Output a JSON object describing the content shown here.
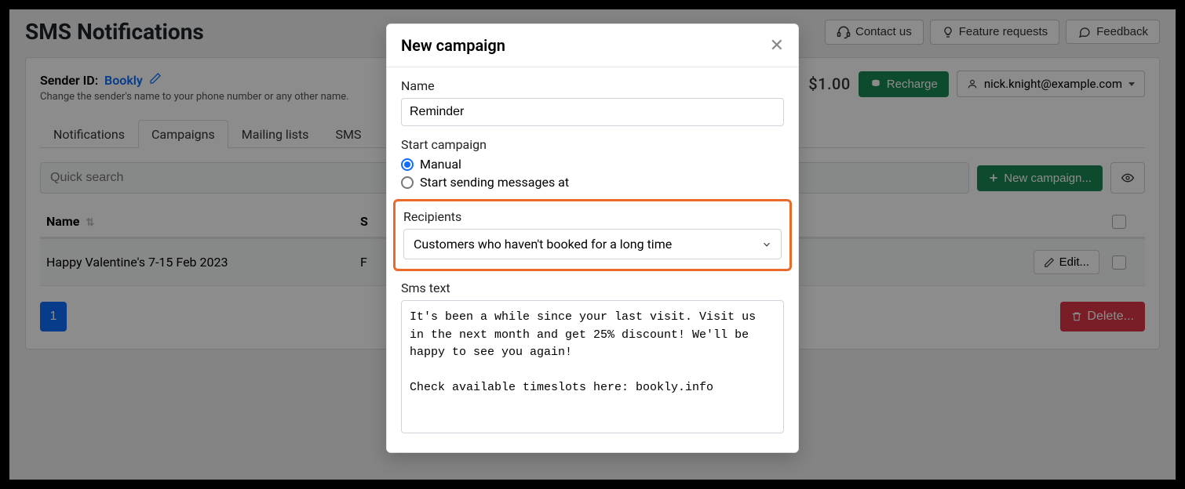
{
  "page": {
    "title": "SMS Notifications"
  },
  "header_buttons": {
    "contact": "Contact us",
    "feature": "Feature requests",
    "feedback": "Feedback"
  },
  "sender": {
    "label": "Sender ID:",
    "value": "Bookly",
    "sub": "Change the sender's name to your phone number or any other name."
  },
  "balance": "$1.00",
  "recharge_label": "Recharge",
  "user_email": "nick.knight@example.com",
  "tabs": {
    "notifications": "Notifications",
    "campaigns": "Campaigns",
    "mailing": "Mailing lists",
    "sms": "SMS"
  },
  "search_placeholder": "Quick search",
  "new_campaign_btn": "New campaign...",
  "table": {
    "col_name": "Name",
    "col_s": "S",
    "row_name": "Happy Valentine's 7-15 Feb 2023",
    "row_s": "F",
    "edit_label": "Edit..."
  },
  "page_number": "1",
  "delete_label": "Delete...",
  "modal": {
    "title": "New campaign",
    "name_label": "Name",
    "name_value": "Reminder",
    "start_label": "Start campaign",
    "opt_manual": "Manual",
    "opt_scheduled": "Start sending messages at",
    "recipients_label": "Recipients",
    "recipients_value": "Customers who haven't booked for a long time",
    "sms_label": "Sms text",
    "sms_value": "It's been a while since your last visit. Visit us in the next month and get 25% discount! We'll be happy to see you again!\n\nCheck available timeslots here: bookly.info"
  }
}
